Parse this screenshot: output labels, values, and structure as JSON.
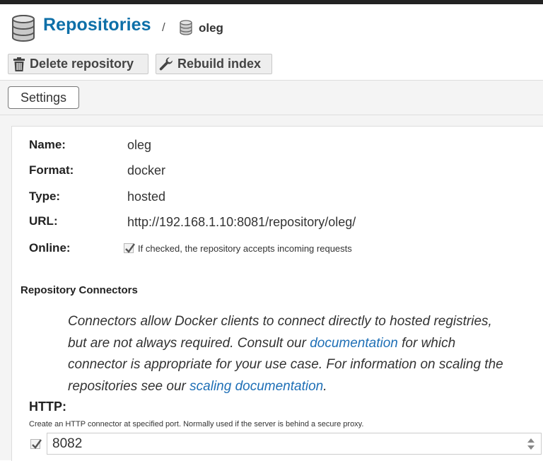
{
  "header": {
    "title": "Repositories",
    "separator": "/",
    "repo_name": "oleg"
  },
  "toolbar": {
    "delete_label": "Delete repository",
    "rebuild_label": "Rebuild index"
  },
  "tabs": {
    "settings_label": "Settings"
  },
  "details": {
    "name_label": "Name:",
    "name_value": "oleg",
    "format_label": "Format:",
    "format_value": "docker",
    "type_label": "Type:",
    "type_value": "hosted",
    "url_label": "URL:",
    "url_value": "http://192.168.1.10:8081/repository/oleg/",
    "online_label": "Online:",
    "online_checked": true,
    "online_help": "If checked, the repository accepts incoming requests"
  },
  "connectors": {
    "title": "Repository Connectors",
    "desc_part1": "Connectors allow Docker clients to connect directly to hosted registries, but are not always required. Consult our ",
    "doc_link": "documentation",
    "desc_part2": " for which connector is appropriate for your use case. For information on scaling the repositories see our ",
    "scaling_link": "scaling documentation",
    "desc_part3": ".",
    "http_label": "HTTP:",
    "http_help": "Create an HTTP connector at specified port. Normally used if the server is behind a secure proxy.",
    "http_checked": true,
    "http_port": "8082"
  },
  "icons": {
    "header": "database-icon",
    "sub": "database-icon",
    "delete": "trash-icon",
    "rebuild": "wrench-icon",
    "checkbox": "checkmark-icon",
    "spinner": "spinner-arrows-icon"
  },
  "colors": {
    "title_blue": "#0d6fa8",
    "link_blue": "#1e6fb6",
    "top_bar": "#222222"
  }
}
